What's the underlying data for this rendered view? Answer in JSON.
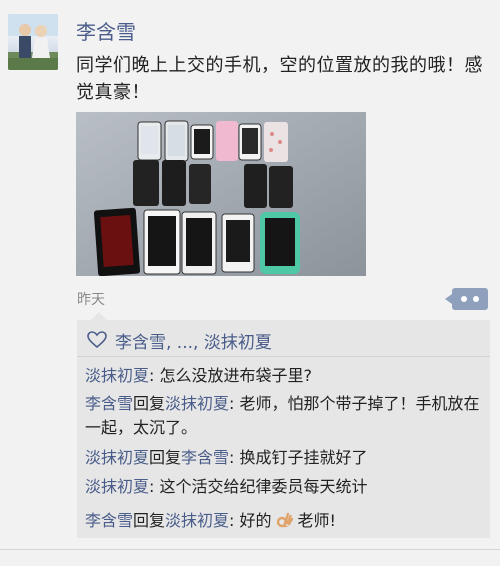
{
  "post": {
    "author": "李含雪",
    "text": "同学们晚上上交的手机，空的位置放的我的哦！感觉真豪！",
    "time": "昨天"
  },
  "likes": {
    "text": "李含雪, ..., 淡抹初夏"
  },
  "comments": [
    {
      "author": "淡抹初夏",
      "reply_label": "",
      "reply_to": "",
      "text": ": 怎么没放进布袋子里?"
    },
    {
      "author": "李含雪",
      "reply_label": "回复",
      "reply_to": "淡抹初夏",
      "text": ": 老师，怕那个带子掉了！手机放在一起，太沉了。"
    },
    {
      "author": "淡抹初夏",
      "reply_label": "回复",
      "reply_to": "李含雪",
      "text": ": 换成钉子挂就好了"
    },
    {
      "author": "淡抹初夏",
      "reply_label": "",
      "reply_to": "",
      "text": ": 这个活交给纪律委员每天统计"
    },
    {
      "author": "李含雪",
      "reply_label": "回复",
      "reply_to": "淡抹初夏",
      "text_before_emoji": ": 好的",
      "text_after_emoji": "老师!"
    }
  ],
  "icons": {
    "heart": "heart-outline-icon",
    "more": "more-dots-icon",
    "emoji": "ok-hand-emoji"
  },
  "colors": {
    "name_link": "#4a5d8a",
    "more_button": "#8fa0bd",
    "comment_bg": "#e6e6e6"
  }
}
